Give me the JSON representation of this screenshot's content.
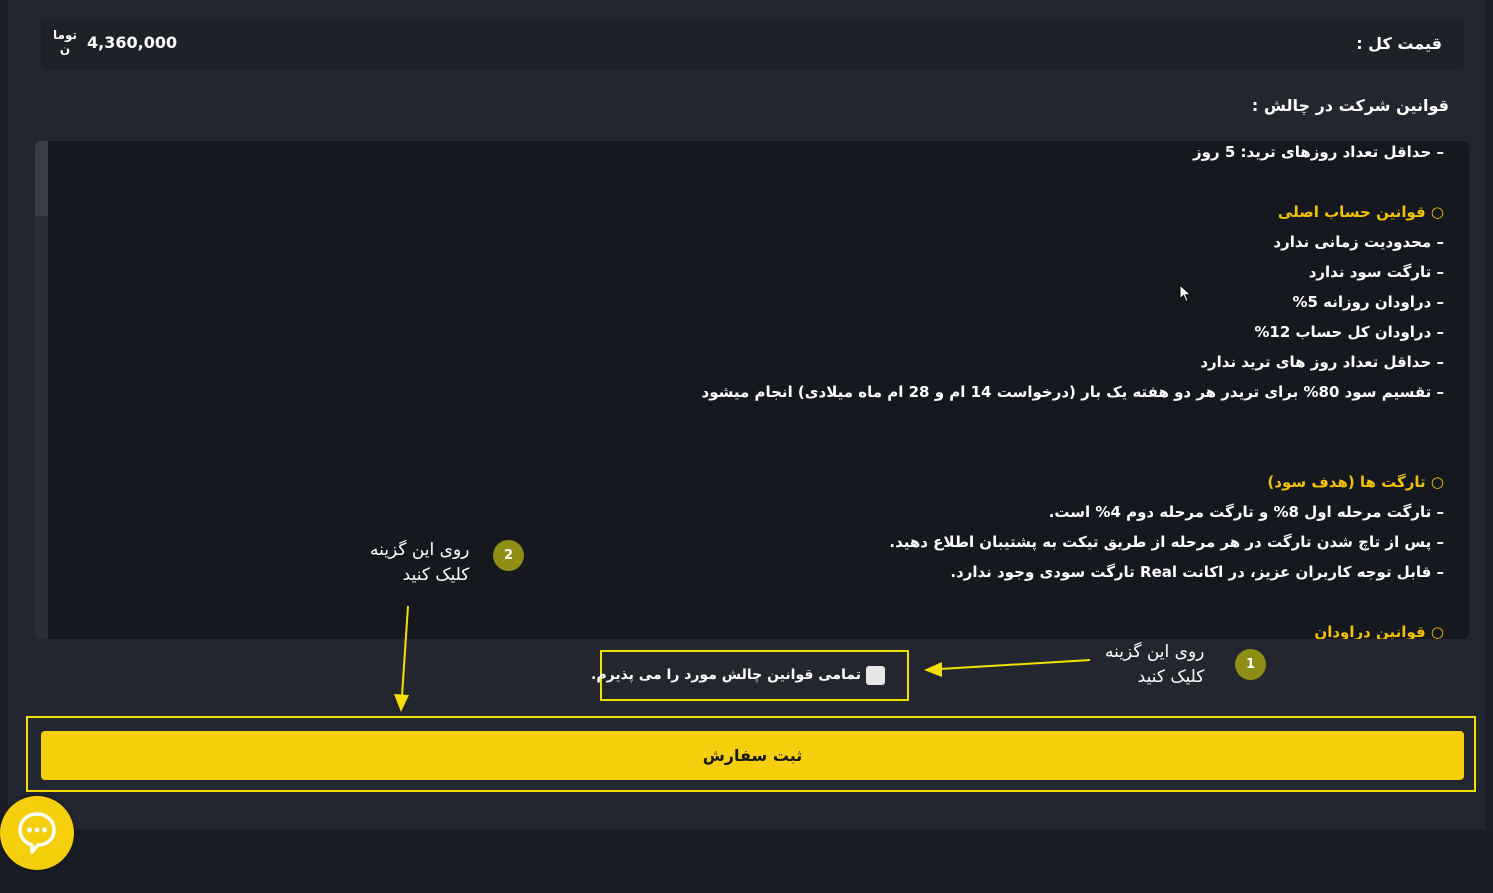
{
  "header": {
    "total_price_label": "قیمت کل :",
    "total_price_value": "4,360,000",
    "currency": "تومان"
  },
  "rules": {
    "heading": "قوانین شرکت در چالش :",
    "lines": [
      {
        "text": "– حداقل تعداد روزهای ترید: 5 روز",
        "section": false
      },
      {
        "text": "○ قوانین حساب اصلی",
        "section": true
      },
      {
        "text": "– محدودیت زمانی ندارد",
        "section": false
      },
      {
        "text": "– تارگت سود ندارد",
        "section": false
      },
      {
        "text": "– دراودان روزانه 5%",
        "section": false
      },
      {
        "text": "– دراودان کل حساب 12%",
        "section": false
      },
      {
        "text": "– حداقل تعداد روز های ترید ندارد",
        "section": false
      },
      {
        "text": "– تقسیم سود 80% برای تریدر هر دو هفته یک بار (درخواست 14 ام و 28 ام ماه میلادی) انجام میشود",
        "section": false
      },
      {
        "text": "○ تارگت ها (هدف سود)",
        "section": true
      },
      {
        "text": "– تارگت مرحله اول 8% و تارگت مرحله دوم 4% است.",
        "section": false
      },
      {
        "text": "– پس از تاچ شدن تارگت در هر مرحله از طریق تیکت به پشتیبان اطلاع دهید.",
        "section": false
      },
      {
        "text": "– قابل توجه کاربران عزیز، در اکانت Real تارگت سودی وجود ندارد.",
        "section": false
      },
      {
        "text": "○ قوانین دراودان",
        "section": true
      }
    ]
  },
  "accept": {
    "label": "تمامی قوانین چالش مورد را می پذیرم."
  },
  "submit": {
    "label": "ثبت سفارش"
  },
  "annotations": {
    "step1": {
      "number": "1",
      "text_line1": "روی این گزینه",
      "text_line2": "کلیک کنید"
    },
    "step2": {
      "number": "2",
      "text_line1": "روی این گزینه",
      "text_line2": "کلیک کنید"
    }
  },
  "colors": {
    "accent": "#f5cf0c",
    "highlight_border": "#f5df00",
    "section_text": "#f2c200",
    "badge": "#8e8e14"
  },
  "icons": {
    "chat": "chat-bubble-icon",
    "cursor": "mouse-pointer-icon"
  }
}
